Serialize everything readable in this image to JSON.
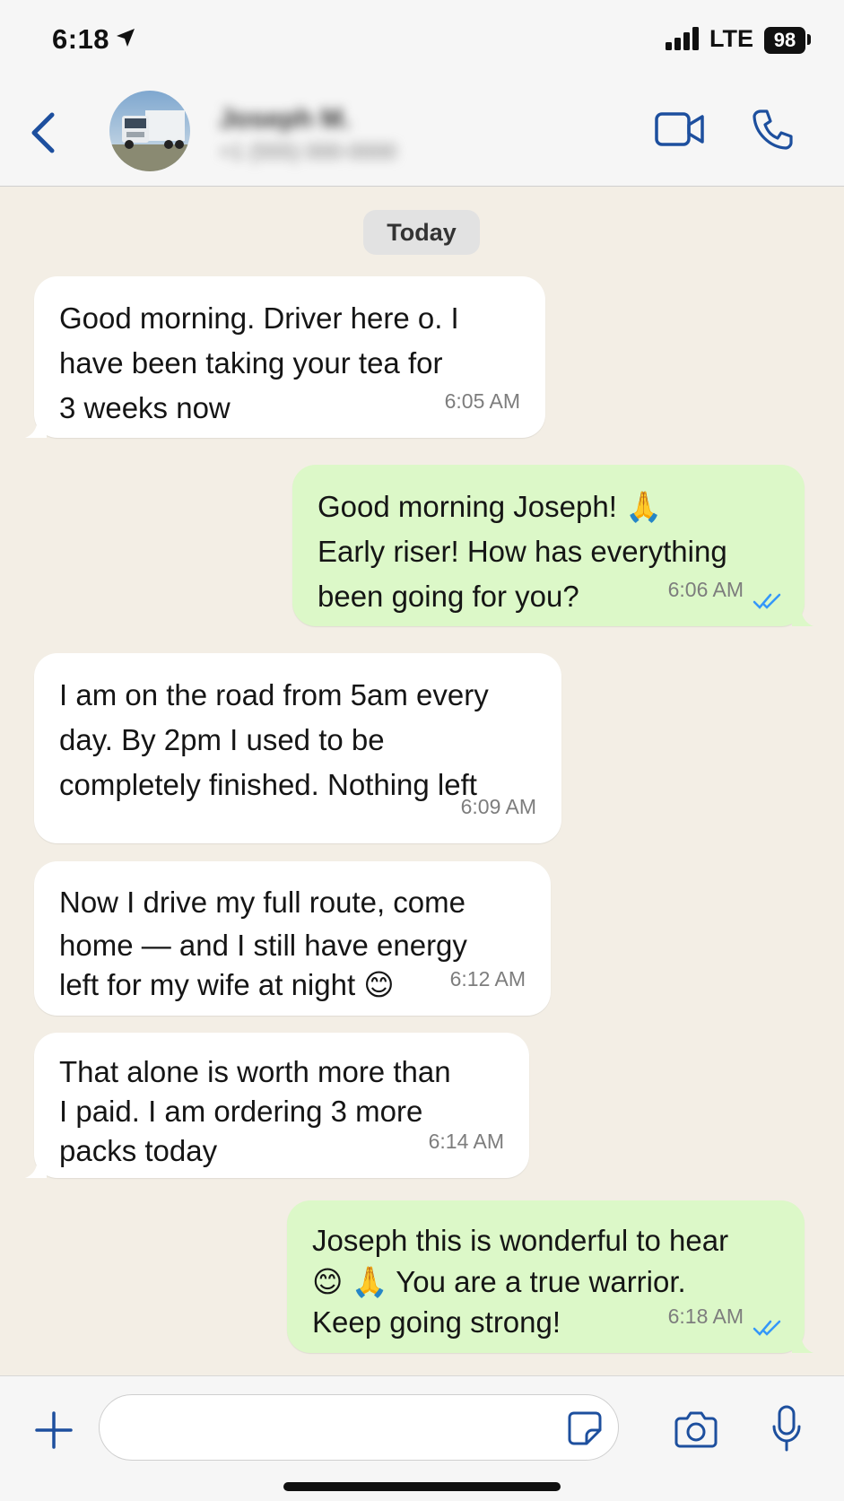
{
  "status_bar": {
    "time": "6:18",
    "network": "LTE",
    "battery": "98"
  },
  "header": {
    "contact_name": "Joseph M.",
    "contact_subtitle": "+1 (555) 000-0000",
    "icons": [
      "back-chevron-icon",
      "video-icon",
      "phone-icon"
    ]
  },
  "chat": {
    "date_label": "Today",
    "messages": [
      {
        "direction": "incoming",
        "lines": [
          "Good morning. Driver here o. I",
          "have been taking your tea for",
          "3 weeks now"
        ],
        "time": "6:05 AM"
      },
      {
        "direction": "outgoing",
        "lines": [
          "Good morning Joseph! 🙏",
          "Early riser! How has everything",
          "been going for you?"
        ],
        "time": "6:06 AM",
        "status": "read"
      },
      {
        "direction": "incoming",
        "lines": [
          "I am on the road from 5am every",
          "day. By 2pm I used to be",
          "completely finished. Nothing left"
        ],
        "time": "6:09 AM"
      },
      {
        "direction": "incoming",
        "lines": [
          "Now I drive my full route, come",
          "home — and I still have energy",
          "left for my wife at night 😊"
        ],
        "time": "6:12 AM"
      },
      {
        "direction": "incoming",
        "lines": [
          "That alone is worth more than",
          "I paid. I am ordering 3 more",
          "packs today"
        ],
        "time": "6:14 AM"
      },
      {
        "direction": "outgoing",
        "lines": [
          "Joseph this is wonderful to hear",
          "😊 🙏 You are a true warrior.",
          "Keep going strong!"
        ],
        "time": "6:18 AM",
        "status": "read"
      }
    ]
  },
  "input_bar": {
    "placeholder": "",
    "icons": [
      "plus-icon",
      "sticker-icon",
      "camera-icon",
      "microphone-icon"
    ]
  },
  "colors": {
    "accent_blue": "#1d4f9e",
    "outgoing_bubble": "#dcf8c8",
    "incoming_bubble": "#ffffff",
    "read_ticks": "#3497f9",
    "chat_background": "#f3eee5"
  }
}
